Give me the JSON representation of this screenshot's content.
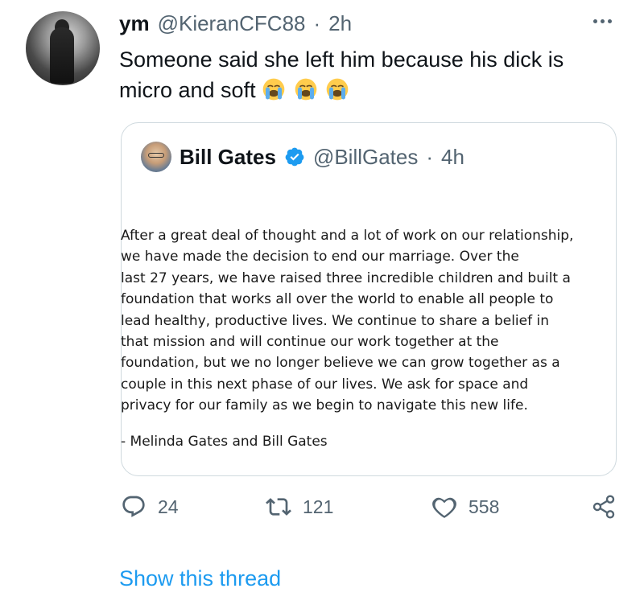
{
  "tweet": {
    "display_name": "ym",
    "handle": "@KieranCFC88",
    "separator": "·",
    "time": "2h",
    "text": "Someone said she left him because his dick is micro and soft",
    "emojis": [
      "loudly-crying-face",
      "loudly-crying-face",
      "loudly-crying-face"
    ]
  },
  "quoted_tweet": {
    "display_name": "Bill Gates",
    "verified": true,
    "handle": "@BillGates",
    "separator": "·",
    "time": "4h",
    "statement_lines": [
      "After a great deal of thought and a lot of work on our relationship,",
      "we have made the decision to end our marriage. Over the",
      "last 27 years, we have raised three incredible children and built a",
      "foundation that works all over the world to enable all people to",
      "lead healthy, productive lives. We continue to share a belief in",
      "that mission and will continue our work together at the",
      "foundation, but we no longer believe we can grow together as a",
      "couple in this next phase of our lives. We ask for space and",
      "privacy for our family as we begin to navigate this new life."
    ],
    "signature": "- Melinda Gates and Bill Gates"
  },
  "actions": {
    "replies": "24",
    "retweets": "121",
    "likes": "558"
  },
  "show_thread": "Show this thread",
  "colors": {
    "text": "#0f1419",
    "secondary": "#536471",
    "link": "#1d9bf0",
    "verified": "#1d9bf0",
    "border": "#cfd9de"
  },
  "icons": [
    "more-icon",
    "verified-icon",
    "reply-icon",
    "retweet-icon",
    "like-icon",
    "share-icon"
  ]
}
